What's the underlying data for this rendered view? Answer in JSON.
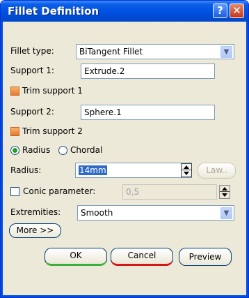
{
  "window": {
    "title": "Fillet Definition",
    "help_glyph": "?",
    "close_glyph": "✕"
  },
  "fillet_type": {
    "label": "Fillet type:",
    "value": "BiTangent Fillet"
  },
  "support1": {
    "label": "Support 1:",
    "value": "Extrude.2"
  },
  "trim_support1": {
    "label": "Trim support 1",
    "checked": true
  },
  "support2": {
    "label": "Support 2:",
    "value": "Sphere.1"
  },
  "trim_support2": {
    "label": "Trim support 2",
    "checked": true
  },
  "section_type": {
    "radius_label": "Radius",
    "chordal_label": "Chordal",
    "selected": "Radius"
  },
  "radius": {
    "label": "Radius:",
    "value": "14mm",
    "law_label": "Law.."
  },
  "conic": {
    "label": "Conic parameter:",
    "value": "0,5",
    "checked": false
  },
  "extremities": {
    "label": "Extremities:",
    "value": "Smooth"
  },
  "more_label": "More >>",
  "buttons": {
    "ok": "OK",
    "cancel": "Cancel",
    "preview": "Preview"
  },
  "colors": {
    "titlebar": "#0050e0",
    "dialog_bg": "#ece9d8",
    "selection": "#316ac5"
  }
}
